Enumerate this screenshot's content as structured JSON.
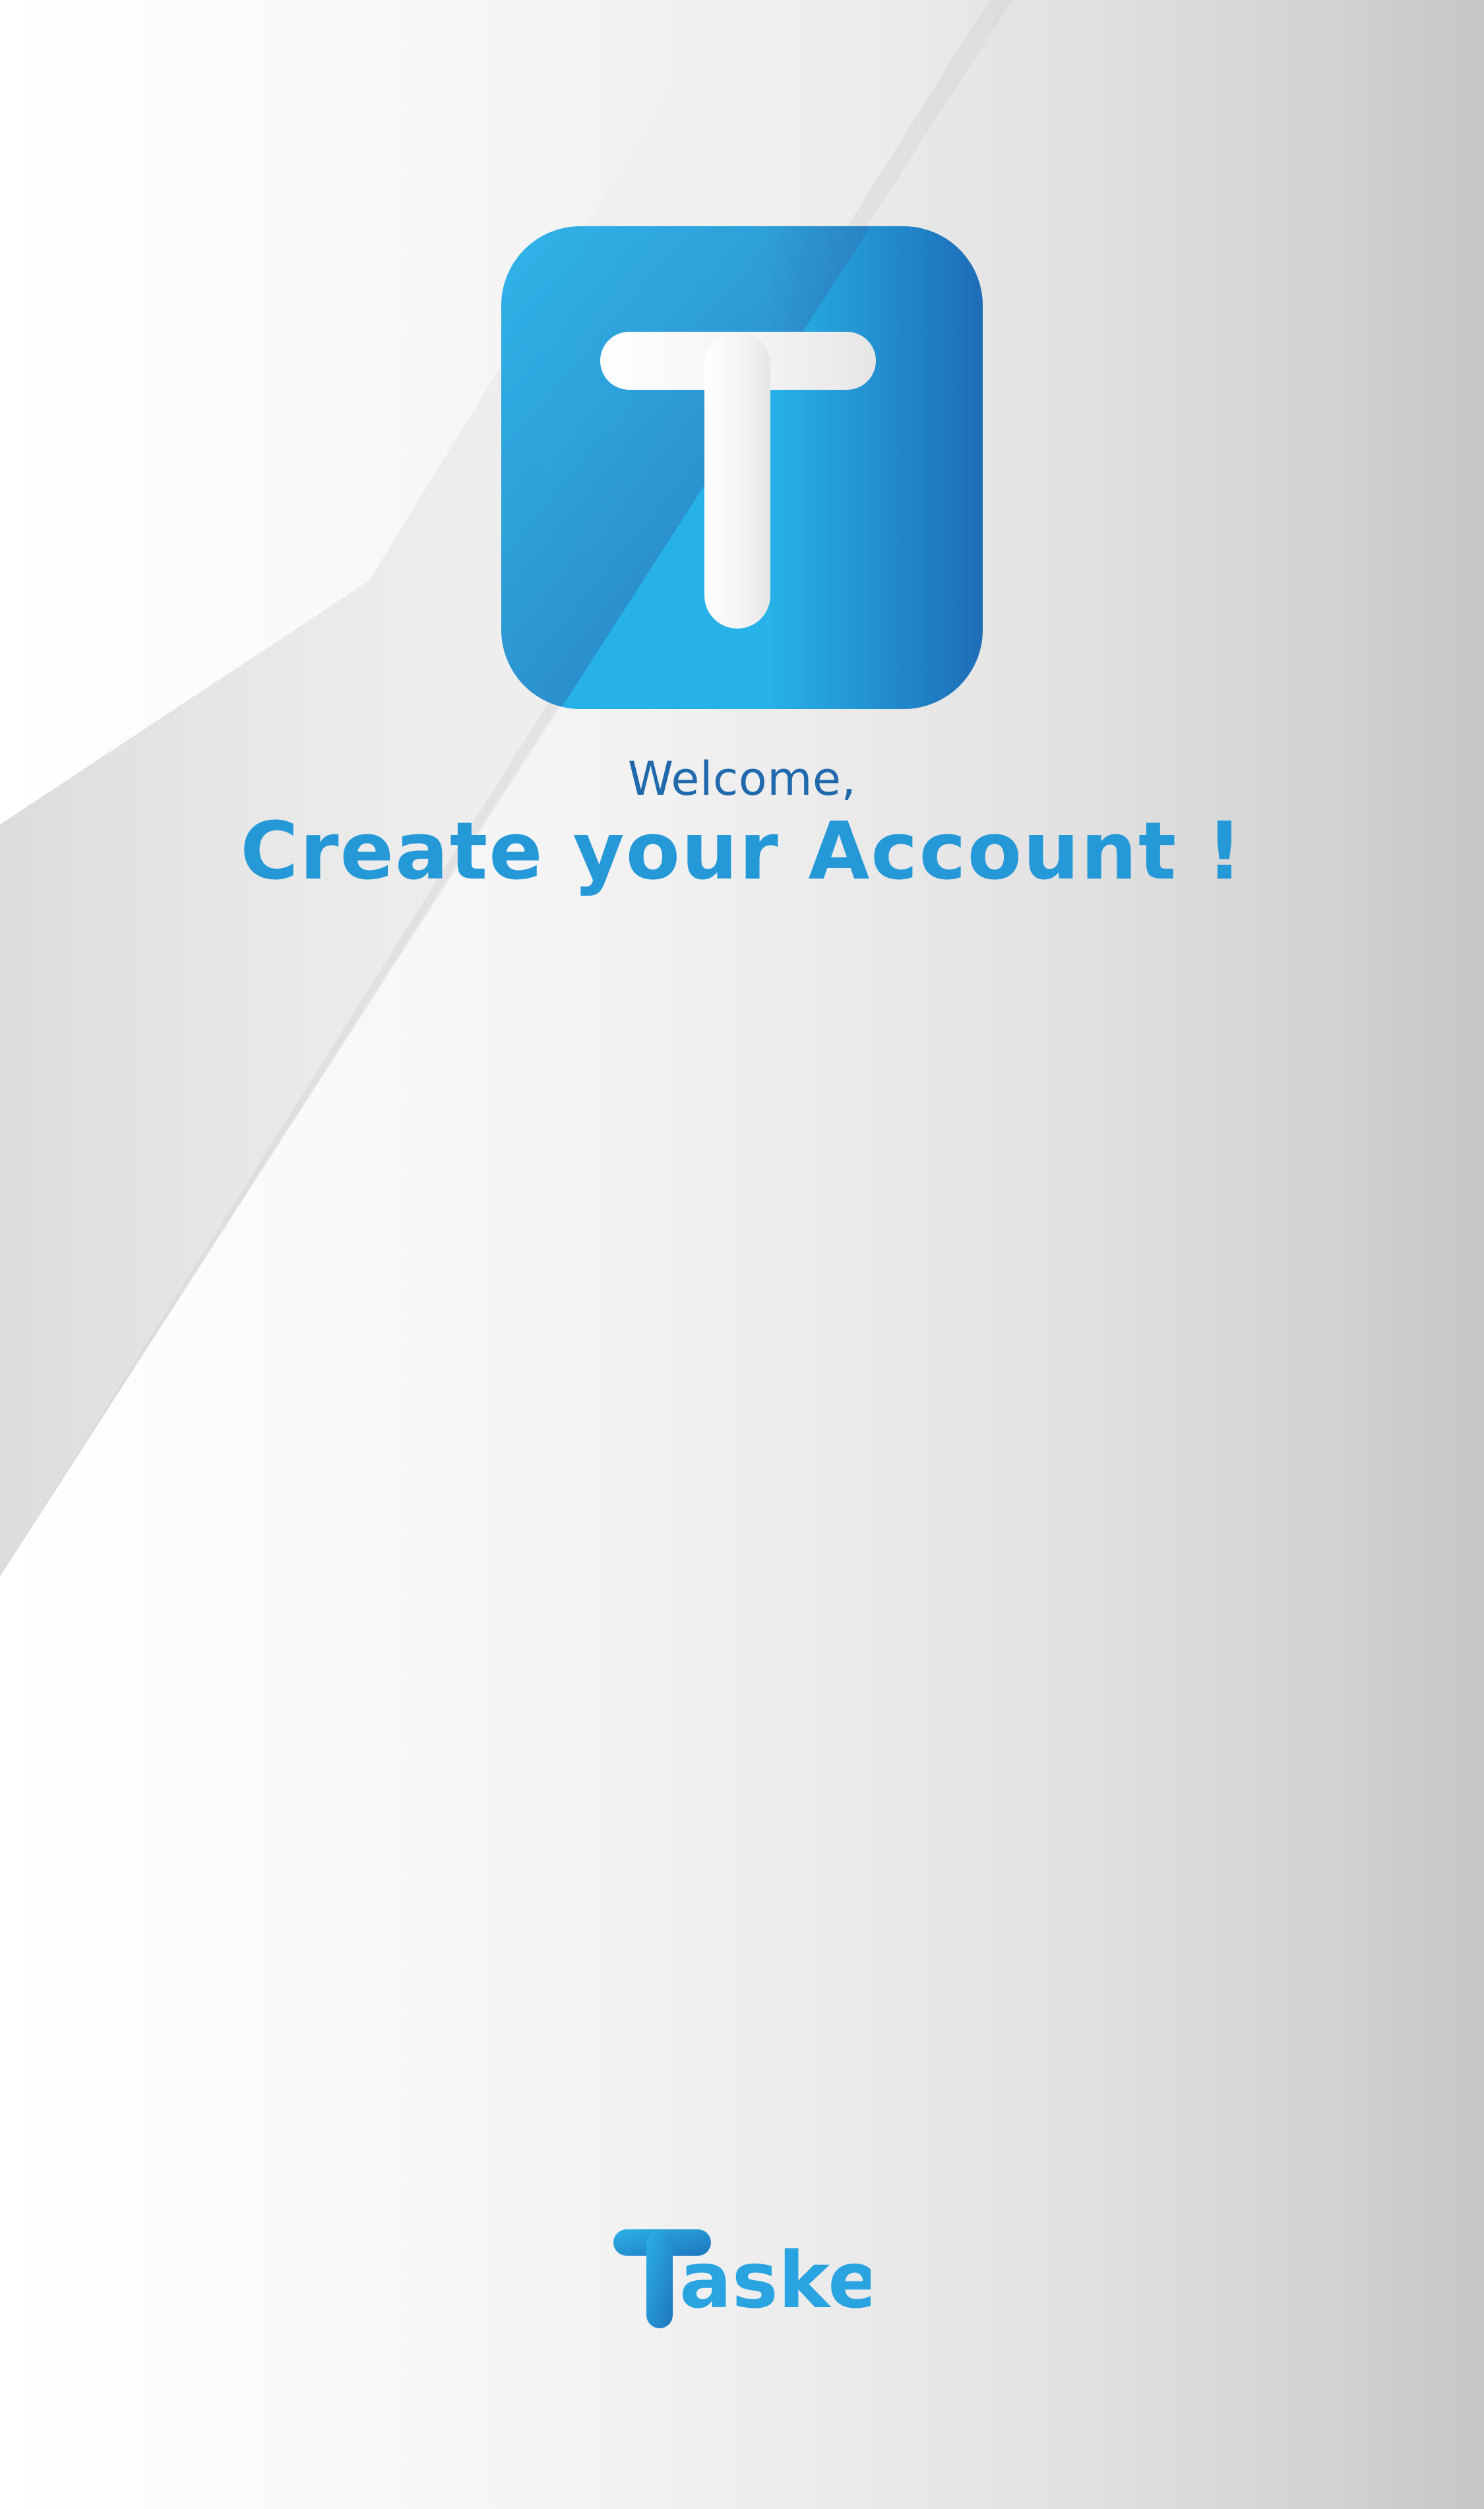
{
  "app_icon": {
    "letter": "T",
    "icon_name": "tasker-app-icon",
    "colors": {
      "light": "#29b6ec",
      "dark": "#1d6fb8"
    }
  },
  "welcome": {
    "greeting": "Welcome,",
    "headline": "Create your Account !"
  },
  "brand": {
    "name_rest": "asker",
    "logo_icon": "tasker-logo-icon"
  },
  "colors": {
    "greeting": "#2069ad",
    "headline": "#2599d8",
    "brand": "#2aa4e0"
  }
}
